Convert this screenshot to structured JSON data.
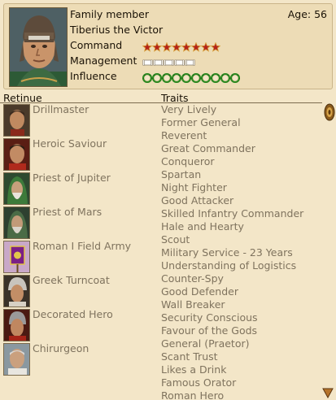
{
  "header": {
    "role": "Family member",
    "name": "Tiberius the Victor",
    "age": "Age: 56"
  },
  "stats": [
    {
      "label": "Command",
      "value": 8,
      "max": 8,
      "icon": "star-icon",
      "color": "#b4231b"
    },
    {
      "label": "Management",
      "value": 5,
      "max": 5,
      "icon": "scroll-icon",
      "color": "#ffffff"
    },
    {
      "label": "Influence",
      "value": 10,
      "max": 10,
      "icon": "laurel-icon",
      "color": "#2e8a22"
    }
  ],
  "retinue": {
    "heading": "Retinue",
    "items": [
      {
        "label": "Drillmaster",
        "icon": "drillmaster-portrait"
      },
      {
        "label": "Heroic Saviour",
        "icon": "heroic-saviour-portrait"
      },
      {
        "label": "Priest of Jupiter",
        "icon": "priest-jupiter-portrait"
      },
      {
        "label": "Priest of Mars",
        "icon": "priest-mars-portrait"
      },
      {
        "label": "Roman I Field Army",
        "icon": "field-army-standard-icon"
      },
      {
        "label": "Greek Turncoat",
        "icon": "greek-turncoat-portrait"
      },
      {
        "label": "Decorated Hero",
        "icon": "decorated-hero-portrait"
      },
      {
        "label": "Chirurgeon",
        "icon": "chirurgeon-portrait"
      }
    ]
  },
  "traits": {
    "heading": "Traits",
    "items": [
      "Very Lively",
      "Former General",
      "Reverent",
      "Great Commander",
      "Conqueror",
      "Spartan",
      "Night Fighter",
      "Good Attacker",
      "Skilled Infantry Commander",
      "Hale and Hearty",
      "Scout",
      "Military Service - 23 Years",
      "Understanding of Logistics",
      "Counter-Spy",
      "Good Defender",
      "Wall Breaker",
      "Security Conscious",
      "Favour of the Gods",
      "General (Praetor)",
      "Scant Trust",
      "Likes a Drink",
      "Famous Orator",
      "Roman Hero"
    ]
  },
  "colors": {
    "background": "#f3e6c8",
    "text_muted": "#7f735e",
    "scroll_bronze": "#a8762c"
  }
}
